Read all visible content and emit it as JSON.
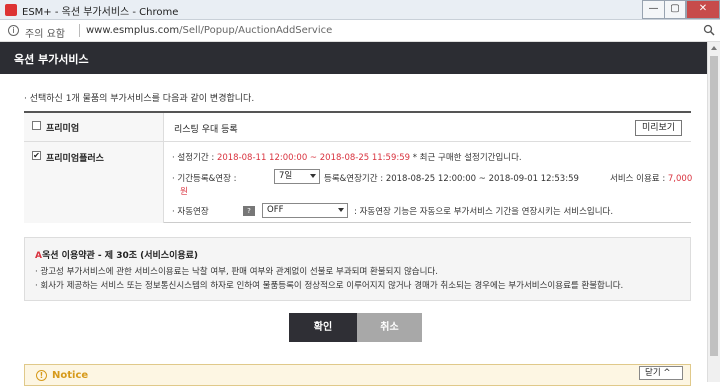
{
  "window": {
    "title": "ESM+ - 옥션 부가서비스 - Chrome",
    "min_label": "—",
    "max_label": "▢",
    "close_label": "✕"
  },
  "address": {
    "security": "주의 요함",
    "domain": "www.esmplus.com",
    "path": "/Sell/Popup/AuctionAddService"
  },
  "popup": {
    "title": "옥션 부가서비스"
  },
  "description": "· 선택하신 1개 물품의 부가서비스를 다음과 같이 변경합니다.",
  "services": {
    "premium": {
      "checked": false,
      "name": "프리미엄",
      "desc": "리스팅 우대 등록",
      "preview_label": "미리보기"
    },
    "premium_plus": {
      "checked": true,
      "check_mark": "✔",
      "name": "프리미엄플러스",
      "line1_prefix": "· 설정기간 : ",
      "line1_period": "2018-08-11 12:00:00 ~ 2018-08-25 11:59:59",
      "line1_suffix": " * 최근 구매한 설정기간입니다.",
      "line2_prefix": "· 기간등록&연장 : ",
      "period_select": "7일",
      "line2_mid": "등록&연장기간 : 2018-08-25 12:00:00 ~ 2018-09-01 12:53:59",
      "fee_label": "서비스 이용료 : ",
      "fee_amount": "7,000",
      "fee_unit": "원",
      "line3_prefix": "· 자동연장",
      "help_label": "?",
      "auto_select": "OFF",
      "line3_suffix": ": 자동연장 기능은 자동으로 부가서비스 기간을 연장시키는 서비스입니다."
    }
  },
  "terms": {
    "head_a": "A",
    "head": "옥션 이용약관 - 제 30조 (서비스이용료)",
    "line1": "· 광고성 부가서비스에 관한 서비스이용료는 낙찰 여부, 판매 여부와 관계없이 선불로 부과되며 환불되지 않습니다.",
    "line2": "· 회사가 제공하는 서비스 또는 정보통신시스템의 하자로 인하여 물품등록이 정상적으로 이루어지지 않거나 경매가 취소되는 경우에는 부가서비스이용료를 환불합니다."
  },
  "buttons": {
    "confirm": "확인",
    "cancel": "취소"
  },
  "notice": {
    "icon": "!",
    "title": "Notice",
    "close_label": "닫기 ^"
  }
}
